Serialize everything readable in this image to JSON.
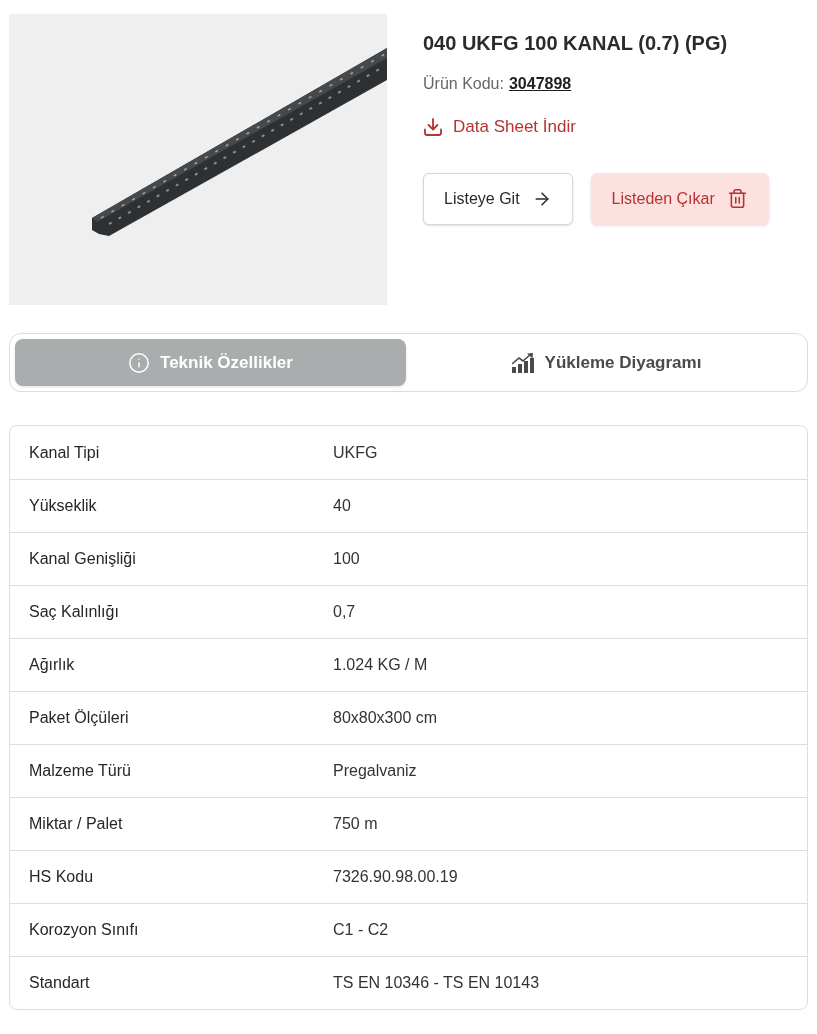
{
  "product": {
    "title": "040 UKFG 100 KANAL (0.7) (PG)",
    "code_label": "Ürün Kodu:",
    "code": "3047898",
    "datasheet": "Data Sheet İndir"
  },
  "actions": [
    {
      "label": "Listeye Git",
      "kind": "go"
    },
    {
      "label": "Listeden Çıkar",
      "kind": "remove"
    }
  ],
  "tabs": [
    {
      "label": "Teknik Özellikler",
      "kind": "info",
      "selected": true
    },
    {
      "label": "Yükleme Diyagramı",
      "kind": "chart",
      "selected": false
    }
  ],
  "specs": [
    {
      "label": "Kanal Tipi",
      "value": "UKFG"
    },
    {
      "label": "Yükseklik",
      "value": "40"
    },
    {
      "label": "Kanal Genişliği",
      "value": "100"
    },
    {
      "label": "Saç Kalınlığı",
      "value": "0,7"
    },
    {
      "label": "Ağırlık",
      "value": "1.024 KG / M"
    },
    {
      "label": "Paket Ölçüleri",
      "value": "80x80x300 cm"
    },
    {
      "label": "Malzeme Türü",
      "value": "Pregalvaniz"
    },
    {
      "label": "Miktar / Palet",
      "value": "750 m"
    },
    {
      "label": "HS Kodu",
      "value": "7326.90.98.00.19"
    },
    {
      "label": "Korozyon Sınıfı",
      "value": "C1 - C2"
    },
    {
      "label": "Standart",
      "value": "TS EN 10346 - TS EN 10143"
    }
  ]
}
